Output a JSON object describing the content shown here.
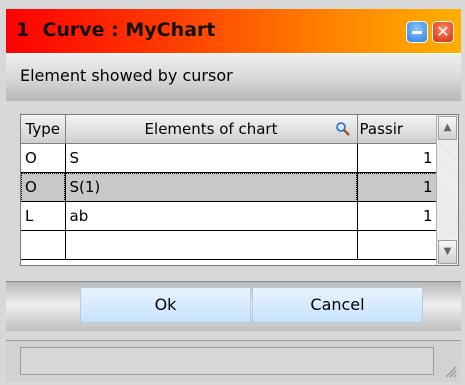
{
  "window": {
    "title": "1  Curve : MyChart",
    "close_glyph": "✕",
    "title_gradient": [
      "#ff0000",
      "#ffb000"
    ]
  },
  "status_top": {
    "text": "Element showed by cursor"
  },
  "grid": {
    "columns": [
      "Type",
      "Elements of chart",
      "Passir"
    ],
    "rows": [
      {
        "type": "O",
        "element": "S",
        "passing": "1"
      },
      {
        "type": "O",
        "element": "S(1)",
        "passing": "1",
        "selected": true
      },
      {
        "type": "L",
        "element": "ab",
        "passing": "1"
      }
    ],
    "header_icon": "magnifier-icon"
  },
  "buttons": {
    "ok": "Ok",
    "cancel": "Cancel"
  },
  "colors": {
    "button_bg": "#c7e2ff",
    "selected_row": "#c8c8c8"
  }
}
